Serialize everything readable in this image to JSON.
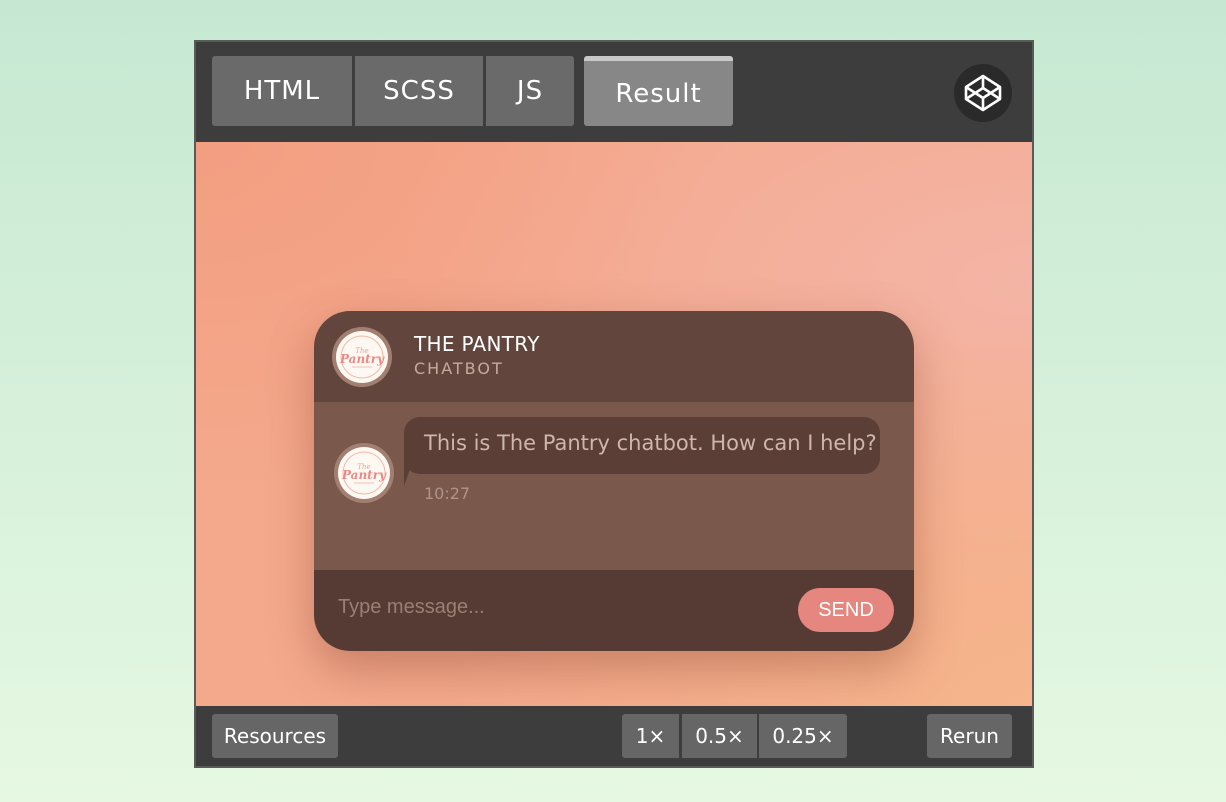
{
  "tabs": {
    "html": "HTML",
    "scss": "SCSS",
    "js": "JS",
    "result": "Result"
  },
  "chat": {
    "title": "THE PANTRY",
    "subtitle": "CHATBOT",
    "logo_text": "Pantry",
    "messages": [
      {
        "text": "This is The Pantry chatbot. How can I help?",
        "time": "10:27"
      }
    ],
    "input_placeholder": "Type message...",
    "send_label": "SEND"
  },
  "bottombar": {
    "resources": "Resources",
    "zoom_options": [
      "1×",
      "0.5×",
      "0.25×"
    ],
    "rerun": "Rerun"
  },
  "colors": {
    "header": "#62463d",
    "body": "#7a584c",
    "footer": "#553b34",
    "send": "#e5877e",
    "chrome": "#3d3d3d"
  },
  "icons": {
    "codepen": "codepen-icon",
    "logo": "pantry-logo"
  }
}
